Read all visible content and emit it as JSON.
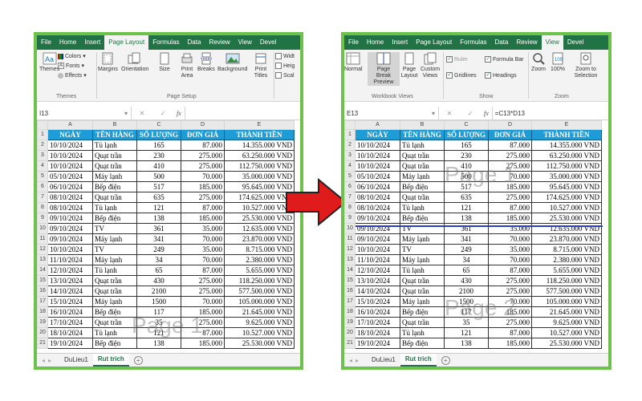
{
  "left": {
    "tabs": [
      "File",
      "Home",
      "Insert",
      "Page Layout",
      "Formulas",
      "Data",
      "Review",
      "View",
      "Devel"
    ],
    "active_tab": "Page Layout",
    "ribbon": {
      "themes": "Themes",
      "colors": "Colors",
      "fonts": "Fonts",
      "effects": "Effects",
      "margins": "Margins",
      "orientation": "Orientation",
      "size": "Size",
      "print_area": "Print Area",
      "breaks": "Breaks",
      "background": "Background",
      "print_titles": "Print Titles",
      "width": "Widt",
      "height": "Heig",
      "scale": "Scal",
      "group_themes": "Themes",
      "group_page_setup": "Page Setup"
    },
    "name_box": "I13",
    "formula": "",
    "watermark": "Page 1",
    "sheets": [
      "DuLieu1",
      "Rut trich"
    ],
    "active_sheet": "Rut trich"
  },
  "right": {
    "tabs": [
      "File",
      "Home",
      "Insert",
      "Page Layout",
      "Formulas",
      "Data",
      "Review",
      "View",
      "Devel"
    ],
    "active_tab": "View",
    "ribbon": {
      "normal": "Normal",
      "page_break_preview": "Page Break Preview",
      "page_layout": "Page Layout",
      "custom_views": "Custom Views",
      "ruler": "Ruler",
      "formula_bar": "Formula Bar",
      "gridlines": "Gridlines",
      "headings": "Headings",
      "zoom": "Zoom",
      "zoom_100": "100%",
      "zoom_to_selection": "Zoom to Selection",
      "group_workbook_views": "Workbook Views",
      "group_show": "Show",
      "group_zoom": "Zoom"
    },
    "name_box": "E13",
    "formula": "=C13*D13",
    "watermark_1": "Page 1",
    "watermark_2": "Page 2",
    "sheets": [
      "DuLieu1",
      "Rut trich"
    ],
    "active_sheet": "Rut trich"
  },
  "columns": [
    "A",
    "B",
    "C",
    "D",
    "E"
  ],
  "headers": [
    "NGÀY",
    "TÊN HÀNG",
    "SỐ LƯỢNG",
    "ĐƠN GIÁ",
    "THÀNH TIỀN"
  ],
  "rows": [
    [
      "10/10/2024",
      "Tủ lạnh",
      "165",
      "87.000",
      "14.355.000 VND"
    ],
    [
      "10/10/2024",
      "Quạt trần",
      "230",
      "275.000",
      "63.250.000 VND"
    ],
    [
      "10/10/2024",
      "Quạt trần",
      "410",
      "275.000",
      "112.750.000 VND"
    ],
    [
      "05/10/2024",
      "Máy lạnh",
      "500",
      "70.000",
      "35.000.000 VND"
    ],
    [
      "06/10/2024",
      "Bếp điện",
      "517",
      "185.000",
      "95.645.000 VND"
    ],
    [
      "08/10/2024",
      "Quạt trần",
      "635",
      "275.000",
      "174.625.000 VND"
    ],
    [
      "08/10/2024",
      "Tủ lạnh",
      "121",
      "87.000",
      "10.527.000 VND"
    ],
    [
      "09/10/2024",
      "Bếp điện",
      "138",
      "185.000",
      "25.530.000 VND"
    ],
    [
      "09/10/2024",
      "TV",
      "361",
      "35.000",
      "12.635.000 VND"
    ],
    [
      "09/10/2024",
      "Máy lạnh",
      "341",
      "70.000",
      "23.870.000 VND"
    ],
    [
      "10/10/2024",
      "TV",
      "249",
      "35.000",
      "8.715.000 VND"
    ],
    [
      "11/10/2024",
      "Máy lạnh",
      "34",
      "70.000",
      "2.380.000 VND"
    ],
    [
      "12/10/2024",
      "Tủ lạnh",
      "65",
      "87.000",
      "5.655.000 VND"
    ],
    [
      "13/10/2024",
      "Quạt trần",
      "430",
      "275.000",
      "118.250.000 VND"
    ],
    [
      "14/10/2024",
      "Quạt trần",
      "2100",
      "275.000",
      "577.500.000 VND"
    ],
    [
      "15/10/2024",
      "Máy lạnh",
      "1500",
      "70.000",
      "105.000.000 VND"
    ],
    [
      "16/10/2024",
      "Bếp điện",
      "117",
      "185.000",
      "21.645.000 VND"
    ],
    [
      "17/10/2024",
      "Quạt trần",
      "35",
      "275.000",
      "9.625.000 VND"
    ],
    [
      "18/10/2024",
      "Tủ lạnh",
      "121",
      "87.000",
      "10.527.000 VND"
    ],
    [
      "19/10/2024",
      "Bếp điện",
      "138",
      "185.000",
      "25.530.000 VND"
    ]
  ],
  "row_numbers": [
    "1",
    "2",
    "3",
    "4",
    "5",
    "6",
    "7",
    "8",
    "9",
    "10",
    "11",
    "12",
    "13",
    "14",
    "15",
    "16",
    "17",
    "18",
    "19",
    "20",
    "21"
  ],
  "colors": {
    "frame": "#6cc24a",
    "header_fill": "#1e9cd7",
    "excel_green": "#217346",
    "arrow": "#e01b1b",
    "page_break": "#2c3fc2"
  }
}
